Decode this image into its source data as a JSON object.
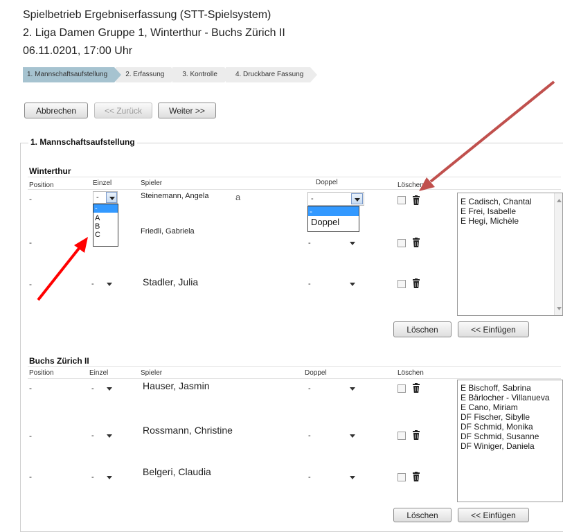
{
  "header": {
    "line1": "Spielbetrieb Ergebniserfassung (STT-Spielsystem)",
    "line2": "2. Liga Damen Gruppe 1, Winterthur - Buchs Zürich II",
    "line3": "06.11.0201, 17:00 Uhr"
  },
  "steps": [
    {
      "label": "1. Mannschaftsaufstellung",
      "active": true
    },
    {
      "label": "2. Erfassung",
      "active": false
    },
    {
      "label": "3. Kontrolle",
      "active": false
    },
    {
      "label": "4. Druckbare Fassung",
      "active": false
    }
  ],
  "buttons": {
    "cancel": "Abbrechen",
    "back": "<< Zurück",
    "next": "Weiter >>"
  },
  "section_title": "1. Mannschaftsaufstellung",
  "columns": {
    "position": "Position",
    "einzel": "Einzel",
    "spieler": "Spieler",
    "doppel": "Doppel",
    "loeschen": "Löschen"
  },
  "team1": {
    "name": "Winterthur",
    "rows": [
      {
        "position": "-",
        "einzel": "-",
        "spieler": "Steinemann, Angela",
        "doppel": "-"
      },
      {
        "position": "-",
        "einzel": "-",
        "spieler": "Friedli, Gabriela",
        "doppel": "-"
      },
      {
        "position": "-",
        "einzel": "-",
        "spieler": "Stadler, Julia",
        "doppel": "-"
      }
    ],
    "einzel_options": [
      "-",
      "A",
      "B",
      "C"
    ],
    "doppel_options": [
      "-",
      "Doppel"
    ],
    "available": [
      "E Cadisch, Chantal",
      "E Frei, Isabelle",
      "E Hegi, Michèle"
    ],
    "delete_button": "Löschen",
    "insert_button": "<< Einfügen"
  },
  "team2": {
    "name": "Buchs Zürich II",
    "rows": [
      {
        "position": "-",
        "einzel": "-",
        "spieler": "Hauser, Jasmin",
        "doppel": "-"
      },
      {
        "position": "-",
        "einzel": "-",
        "spieler": "Rossmann, Christine",
        "doppel": "-"
      },
      {
        "position": "-",
        "einzel": "-",
        "spieler": "Belgeri, Claudia",
        "doppel": "-"
      }
    ],
    "available": [
      "E Bischoff, Sabrina",
      "E Bärlocher - Villanueva",
      "E Cano, Miriam",
      "DF Fischer, Sibylle",
      "DF Schmid, Monika",
      "DF Schmid, Susanne",
      "DF Winiger, Daniela"
    ],
    "delete_button": "Löschen",
    "insert_button": "<< Einfügen"
  },
  "colors": {
    "active_step": "#a6c3d0",
    "highlight": "#3399ff",
    "arrow": "#c0504d",
    "arrow2": "#ff0000"
  }
}
